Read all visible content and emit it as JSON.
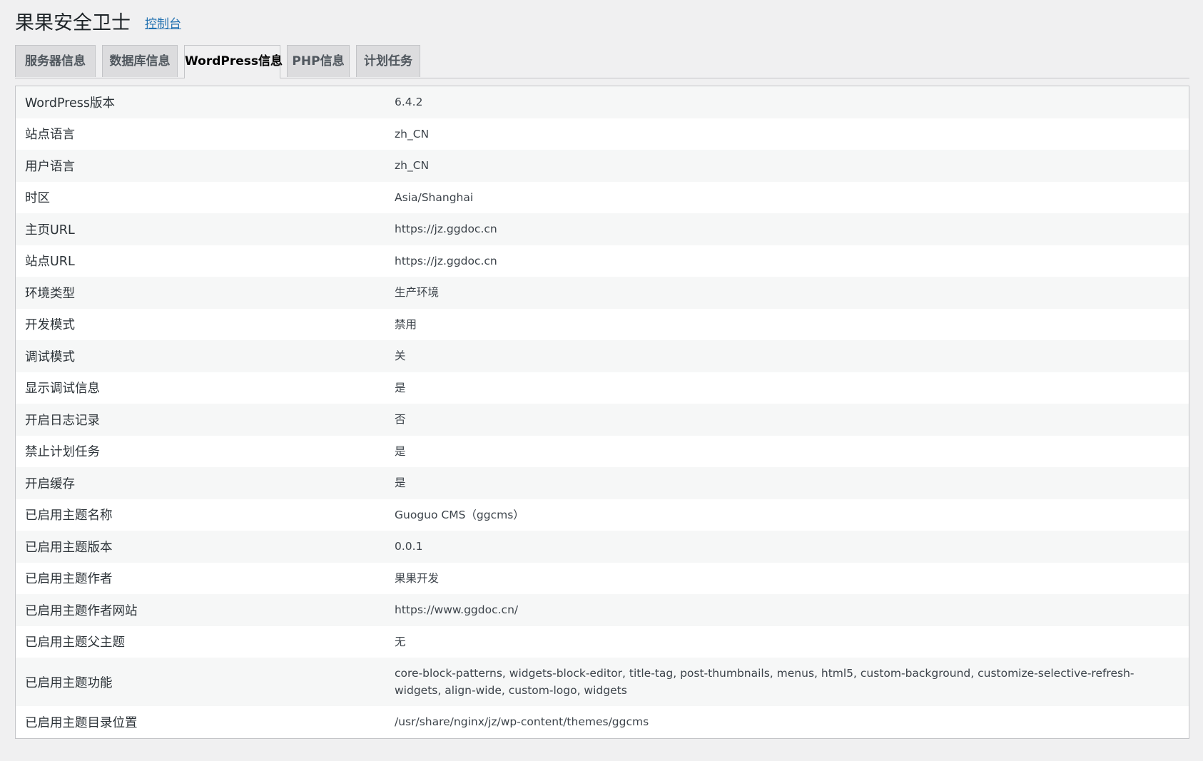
{
  "header": {
    "title": "果果安全卫士",
    "console_link": "控制台"
  },
  "tabs": [
    {
      "label": "服务器信息",
      "active": false
    },
    {
      "label": "数据库信息",
      "active": false
    },
    {
      "label": "WordPress信息",
      "active": true
    },
    {
      "label": "PHP信息",
      "active": false
    },
    {
      "label": "计划任务",
      "active": false
    }
  ],
  "rows": [
    {
      "key": "WordPress版本",
      "value": "6.4.2"
    },
    {
      "key": "站点语言",
      "value": "zh_CN"
    },
    {
      "key": "用户语言",
      "value": "zh_CN"
    },
    {
      "key": "时区",
      "value": "Asia/Shanghai"
    },
    {
      "key": "主页URL",
      "value": "https://jz.ggdoc.cn"
    },
    {
      "key": "站点URL",
      "value": "https://jz.ggdoc.cn"
    },
    {
      "key": "环境类型",
      "value": "生产环境"
    },
    {
      "key": "开发模式",
      "value": "禁用"
    },
    {
      "key": "调试模式",
      "value": "关"
    },
    {
      "key": "显示调试信息",
      "value": "是"
    },
    {
      "key": "开启日志记录",
      "value": "否"
    },
    {
      "key": "禁止计划任务",
      "value": "是"
    },
    {
      "key": "开启缓存",
      "value": "是"
    },
    {
      "key": "已启用主题名称",
      "value": "Guoguo CMS（ggcms）"
    },
    {
      "key": "已启用主题版本",
      "value": "0.0.1"
    },
    {
      "key": "已启用主题作者",
      "value": "果果开发"
    },
    {
      "key": "已启用主题作者网站",
      "value": "https://www.ggdoc.cn/"
    },
    {
      "key": "已启用主题父主题",
      "value": "无"
    },
    {
      "key": "已启用主题功能",
      "value": "core-block-patterns, widgets-block-editor, title-tag, post-thumbnails, menus, html5, custom-background, customize-selective-refresh-widgets, align-wide, custom-logo, widgets"
    },
    {
      "key": "已启用主题目录位置",
      "value": "/usr/share/nginx/jz/wp-content/themes/ggcms"
    }
  ]
}
